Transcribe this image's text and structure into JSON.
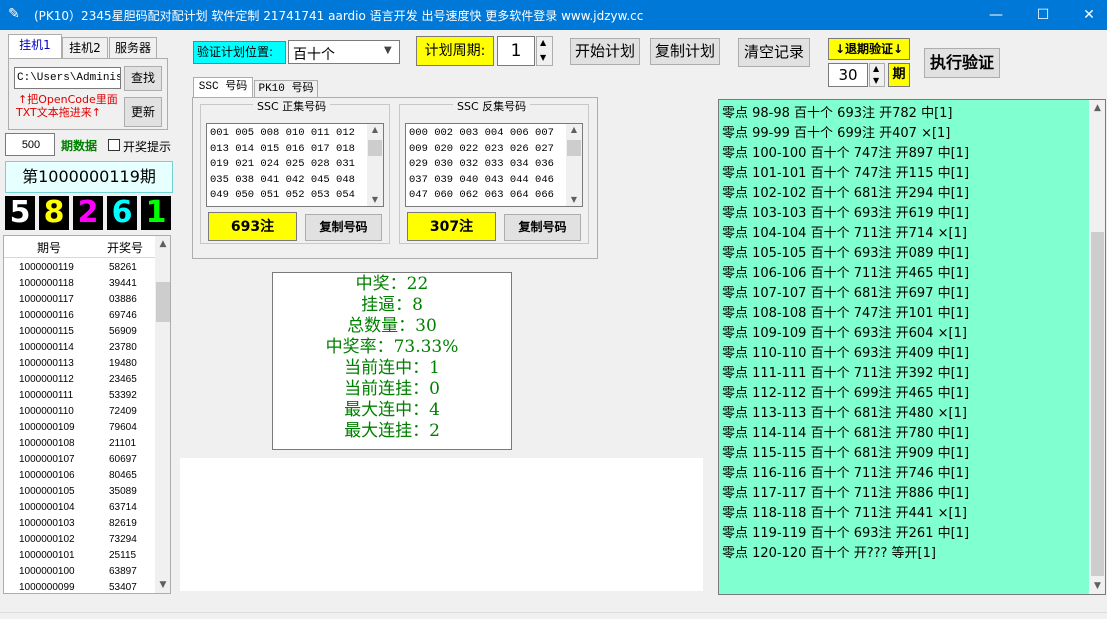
{
  "window": {
    "title": "(PK10）2345星胆码配对配计划 软件定制 21741741 aardio 语言开发 出号速度快 更多软件登录 www.jdzyw.cc",
    "minimize_glyph": "—",
    "maximize_glyph": "☐",
    "close_glyph": "✕"
  },
  "left_tabs": [
    "挂机1",
    "挂机2",
    "服务器"
  ],
  "path_input": "C:\\Users\\Administ",
  "browse_button": "查找",
  "hint_line1": "↑把OpenCode里面",
  "hint_line2": "TXT文本拖进来↑",
  "update_button": "更新",
  "period_count": "500",
  "period_label": "期数据",
  "lottery_alert_label": "开奖提示",
  "current_issue": "第1000000119期",
  "draw_digits": [
    {
      "d": "5",
      "color": "#ffffff"
    },
    {
      "d": "8",
      "color": "#ffff00"
    },
    {
      "d": "2",
      "color": "#ff00ff"
    },
    {
      "d": "6",
      "color": "#00ffff"
    },
    {
      "d": "1",
      "color": "#00ff00"
    }
  ],
  "history": {
    "headers": [
      "期号",
      "开奖号"
    ],
    "rows": [
      [
        "1000000119",
        "58261"
      ],
      [
        "1000000118",
        "39441"
      ],
      [
        "1000000117",
        "03886"
      ],
      [
        "1000000116",
        "69746"
      ],
      [
        "1000000115",
        "56909"
      ],
      [
        "1000000114",
        "23780"
      ],
      [
        "1000000113",
        "19480"
      ],
      [
        "1000000112",
        "23465"
      ],
      [
        "1000000111",
        "53392"
      ],
      [
        "1000000110",
        "72409"
      ],
      [
        "1000000109",
        "79604"
      ],
      [
        "1000000108",
        "21101"
      ],
      [
        "1000000107",
        "60697"
      ],
      [
        "1000000106",
        "80465"
      ],
      [
        "1000000105",
        "35089"
      ],
      [
        "1000000104",
        "63714"
      ],
      [
        "1000000103",
        "82619"
      ],
      [
        "1000000102",
        "73294"
      ],
      [
        "1000000101",
        "25115"
      ],
      [
        "1000000100",
        "63897"
      ],
      [
        "1000000099",
        "53407"
      ]
    ]
  },
  "toolbar": {
    "verify_position_label": "验证计划位置:",
    "verify_position_value": "百十个",
    "cycle_label": "计划周期:",
    "cycle_value": "1",
    "start_plan": "开始计划",
    "copy_plan": "复制计划",
    "clear_log": "清空记录",
    "back_verify_label": "↓退期验证↓",
    "back_verify_value": "30",
    "back_verify_unit": "期",
    "execute_verify": "执行验证"
  },
  "code_tabs": [
    "SSC 号码",
    "PK10 号码"
  ],
  "positive_set": {
    "legend": "SSC 正集号码",
    "lines": [
      "001 005 008 010 011 012",
      "013 014 015 016 017 018",
      "019 021 024 025 028 031",
      "035 038 041 042 045 048",
      "049 050 051 052 053 054"
    ],
    "count": "693注",
    "copy": "复制号码"
  },
  "negative_set": {
    "legend": "SSC 反集号码",
    "lines": [
      "000 002 003 004 006 007",
      "009 020 022 023 026 027",
      "029 030 032 033 034 036",
      "037 039 040 043 044 046",
      "047 060 062 063 064 066"
    ],
    "count": "307注",
    "copy": "复制号码"
  },
  "stats": [
    "中奖：22",
    "挂逼：8",
    "总数量：30",
    "中奖率：73.33%",
    "当前连中：1",
    "当前连挂：0",
    "最大连中：4",
    "最大连挂：2"
  ],
  "log_lines": [
    "零点 98-98 百十个 693注 开782 中[1]",
    "零点 99-99 百十个 699注 开407 ×[1]",
    "零点 100-100 百十个 747注 开897 中[1]",
    "零点 101-101 百十个 747注 开115 中[1]",
    "零点 102-102 百十个 681注 开294 中[1]",
    "零点 103-103 百十个 693注 开619 中[1]",
    "零点 104-104 百十个 711注 开714 ×[1]",
    "零点 105-105 百十个 693注 开089 中[1]",
    "零点 106-106 百十个 711注 开465 中[1]",
    "零点 107-107 百十个 681注 开697 中[1]",
    "零点 108-108 百十个 747注 开101 中[1]",
    "零点 109-109 百十个 693注 开604 ×[1]",
    "零点 110-110 百十个 693注 开409 中[1]",
    "零点 111-111 百十个 711注 开392 中[1]",
    "零点 112-112 百十个 699注 开465 中[1]",
    "零点 113-113 百十个 681注 开480 ×[1]",
    "零点 114-114 百十个 681注 开780 中[1]",
    "零点 115-115 百十个 681注 开909 中[1]",
    "零点 116-116 百十个 711注 开746 中[1]",
    "零点 117-117 百十个 711注 开886 中[1]",
    "零点 118-118 百十个 711注 开441 ×[1]",
    "零点 119-119 百十个 693注 开261 中[1]",
    "零点 120-120 百十个 开??? 等开[1]"
  ],
  "colors": {
    "titlebar": "#0078d7",
    "log_background": "#80ffd0",
    "stats_text": "#008000",
    "highlight_yellow": "#ffff00",
    "hint_red": "#e00000"
  }
}
